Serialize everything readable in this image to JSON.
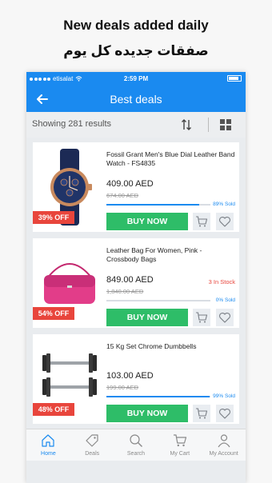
{
  "promo": {
    "headline_en": "New deals added daily",
    "headline_ar": "صفقات جديده كل يوم"
  },
  "status_bar": {
    "carrier": "etisalat",
    "time": "2:59 PM"
  },
  "nav": {
    "title": "Best deals",
    "back_icon": "arrow-left-icon"
  },
  "results": {
    "text": "Showing 281 results",
    "sort_icon": "sort-arrows-icon",
    "view_icon": "grid-icon"
  },
  "products": [
    {
      "title": "Fossil Grant Men's Blue Dial Leather Band Watch - FS4835",
      "price": "409.00 AED",
      "old_price": "674.00 AED",
      "sold_pct": 0.89,
      "sold_label": "89% Sold",
      "stock": "",
      "discount": "39% OFF",
      "buy_label": "BUY NOW",
      "image": "watch-image"
    },
    {
      "title": "Leather Bag For Women, Pink - Crossbody Bags",
      "price": "849.00 AED",
      "old_price": "1,840.00 AED",
      "sold_pct": 0.0,
      "sold_label": "0% Sold",
      "stock": "3 In Stock",
      "discount": "54% OFF",
      "buy_label": "BUY NOW",
      "image": "pink-bag-image"
    },
    {
      "title": "15 Kg Set Chrome Dumbbells",
      "price": "103.00 AED",
      "old_price": "199.00 AED",
      "sold_pct": 0.99,
      "sold_label": "99% Sold",
      "stock": "",
      "discount": "48% OFF",
      "buy_label": "BUY NOW",
      "image": "dumbbells-image"
    }
  ],
  "tabbar": [
    {
      "label": "Home",
      "icon": "home-icon",
      "active": true
    },
    {
      "label": "Deals",
      "icon": "tag-icon",
      "active": false
    },
    {
      "label": "Search",
      "icon": "search-icon",
      "active": false
    },
    {
      "label": "My Cart",
      "icon": "cart-icon",
      "active": false
    },
    {
      "label": "My Account",
      "icon": "user-icon",
      "active": false
    }
  ],
  "colors": {
    "primary": "#1a8af0",
    "buy": "#2ebd68",
    "discount": "#e8453c"
  }
}
